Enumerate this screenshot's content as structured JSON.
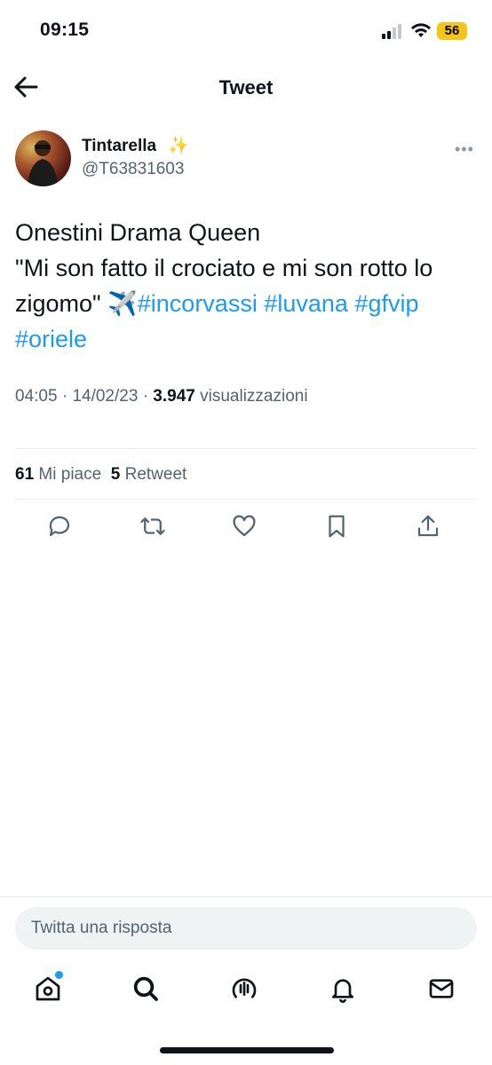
{
  "status_bar": {
    "time": "09:15",
    "battery": "56"
  },
  "header": {
    "title": "Tweet"
  },
  "author": {
    "name": "Tintarella",
    "name_emoji": "✨",
    "handle": "@T63831603"
  },
  "tweet": {
    "line1": "Onestini Drama Queen",
    "line2": "\"Mi son fatto il crociato e mi son rotto lo zigomo\"",
    "emoji": "✈️",
    "hashtags": [
      "#incorvassi",
      "#luvana",
      "#gfvip",
      "#oriele"
    ]
  },
  "meta": {
    "time": "04:05",
    "sep": "·",
    "date": "14/02/23",
    "views_count": "3.947",
    "views_label": "visualizzazioni"
  },
  "stats": {
    "likes_count": "61",
    "likes_label": "Mi piace",
    "retweets_count": "5",
    "retweets_label": "Retweet"
  },
  "actions": [
    "reply-icon",
    "retweet-icon",
    "like-icon",
    "bookmark-icon",
    "share-icon"
  ],
  "reply": {
    "placeholder": "Twitta una risposta"
  },
  "bottom_nav": [
    "home-icon",
    "search-icon",
    "spaces-icon",
    "notifications-icon",
    "messages-icon"
  ],
  "colors": {
    "accent": "#1d9bf0",
    "text": "#0f1419",
    "secondary": "#536471",
    "battery": "#f5c518"
  }
}
